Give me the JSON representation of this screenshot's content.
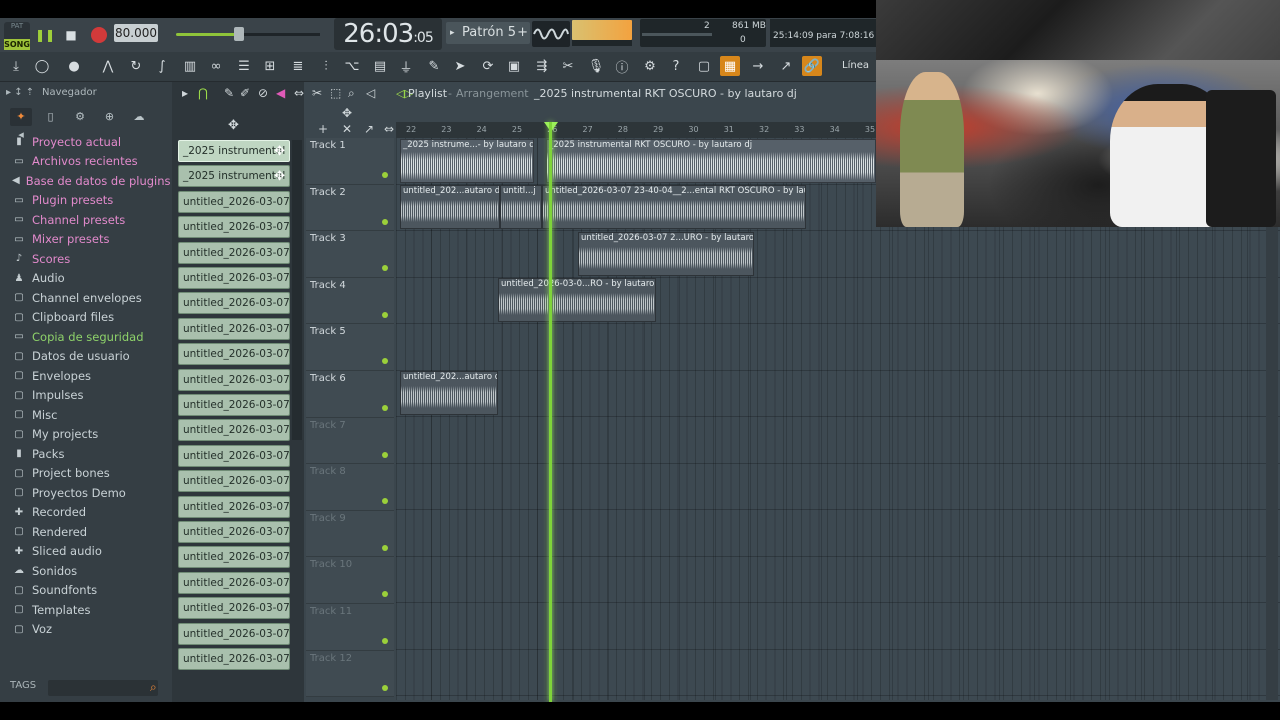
{
  "transport": {
    "song_label": "SONG",
    "pat_label": "PAT",
    "tempo": "80.000",
    "time_main": "26:03",
    "time_sub": "05",
    "pattern_name": "Patrón 5",
    "cpu_voices": "2",
    "memory": "861 MB",
    "cpu_zero": "0",
    "hint": "25:14:09 para 7:08:16 u"
  },
  "toolbar": {
    "linea": "Línea"
  },
  "browser": {
    "header": "Navegador",
    "items": [
      {
        "label": "Proyecto actual",
        "icon": "project-icon",
        "color": "pink"
      },
      {
        "label": "Archivos recientes",
        "icon": "recent-folder-icon",
        "color": "pink"
      },
      {
        "label": "Base de datos de plugins",
        "icon": "plugin-db-icon",
        "color": "pink"
      },
      {
        "label": "Plugin presets",
        "icon": "preset-icon",
        "color": "pink"
      },
      {
        "label": "Channel presets",
        "icon": "preset-icon",
        "color": "pink"
      },
      {
        "label": "Mixer presets",
        "icon": "preset-icon",
        "color": "pink"
      },
      {
        "label": "Scores",
        "icon": "note-icon",
        "color": "pink"
      },
      {
        "label": "Audio",
        "icon": "person-icon",
        "color": "norm"
      },
      {
        "label": "Channel envelopes",
        "icon": "folder-icon",
        "color": "norm"
      },
      {
        "label": "Clipboard files",
        "icon": "folder-icon",
        "color": "norm"
      },
      {
        "label": "Copia de seguridad",
        "icon": "backup-folder-icon",
        "color": "green"
      },
      {
        "label": "Datos de usuario",
        "icon": "folder-icon",
        "color": "norm"
      },
      {
        "label": "Envelopes",
        "icon": "folder-icon",
        "color": "norm"
      },
      {
        "label": "Impulses",
        "icon": "folder-icon",
        "color": "norm"
      },
      {
        "label": "Misc",
        "icon": "folder-icon",
        "color": "norm"
      },
      {
        "label": "My projects",
        "icon": "folder-icon",
        "color": "norm"
      },
      {
        "label": "Packs",
        "icon": "packs-icon",
        "color": "norm"
      },
      {
        "label": "Project bones",
        "icon": "folder-icon",
        "color": "norm"
      },
      {
        "label": "Proyectos Demo",
        "icon": "folder-icon",
        "color": "norm"
      },
      {
        "label": "Recorded",
        "icon": "recorded-icon",
        "color": "norm"
      },
      {
        "label": "Rendered",
        "icon": "folder-icon",
        "color": "norm"
      },
      {
        "label": "Sliced audio",
        "icon": "sliced-icon",
        "color": "norm"
      },
      {
        "label": "Sonidos",
        "icon": "cloud-icon",
        "color": "norm"
      },
      {
        "label": "Soundfonts",
        "icon": "folder-icon",
        "color": "norm"
      },
      {
        "label": "Templates",
        "icon": "folder-icon",
        "color": "norm"
      },
      {
        "label": "Voz",
        "icon": "folder-icon",
        "color": "norm"
      }
    ],
    "tags_label": "TAGS"
  },
  "picker": {
    "clips": [
      "_2025 instrumental R...",
      "_2025 instrumental R...",
      "untitled_2026-03-07 23-...",
      "untitled_2026-03-07 23-...",
      "untitled_2026-03-07 23-...",
      "untitled_2026-03-07 23-...",
      "untitled_2026-03-07 23-...",
      "untitled_2026-03-07 23-...",
      "untitled_2026-03-07 23-...",
      "untitled_2026-03-07 23-...",
      "untitled_2026-03-07 23-...",
      "untitled_2026-03-07 23-...",
      "untitled_2026-03-07 23-...",
      "untitled_2026-03-07 23-...",
      "untitled_2026-03-07 23-...",
      "untitled_2026-03-07 23-...",
      "untitled_2026-03-07 23-...",
      "untitled_2026-03-07 23-...",
      "untitled_2026-03-07 23-...",
      "untitled_2026-03-07 23-...",
      "untitled_2026-03-07 23-..."
    ]
  },
  "playlist": {
    "title": "Playlist",
    "subtitle": "Arrangement",
    "project": "_2025 instrumental RKT OSCURO - by lautaro dj",
    "ruler": [
      "22",
      "23",
      "24",
      "25",
      "26",
      "27",
      "28",
      "29",
      "30",
      "31",
      "32",
      "33",
      "34",
      "35"
    ],
    "tracks": [
      "Track 1",
      "Track 2",
      "Track 3",
      "Track 4",
      "Track 5",
      "Track 6",
      "Track 7",
      "Track 8",
      "Track 9",
      "Track 10",
      "Track 11",
      "Track 12"
    ],
    "clips": {
      "t1a": "_2025 instrume...- by lautaro dj",
      "t1b": "_2025 instrumental RKT OSCURO - by lautaro dj",
      "t2a": "untitled_202...autaro dj",
      "t2b": "untitl...j",
      "t2c": "untitled_2026-03-07 23-40-04__2...ental RKT OSCURO - by lautaro dj",
      "t3": "untitled_2026-03-07 2...URO - by lautaro dj",
      "t4": "untitled_2026-03-0...RO - by lautaro dj",
      "t6": "untitled_202...autaro dj"
    }
  }
}
